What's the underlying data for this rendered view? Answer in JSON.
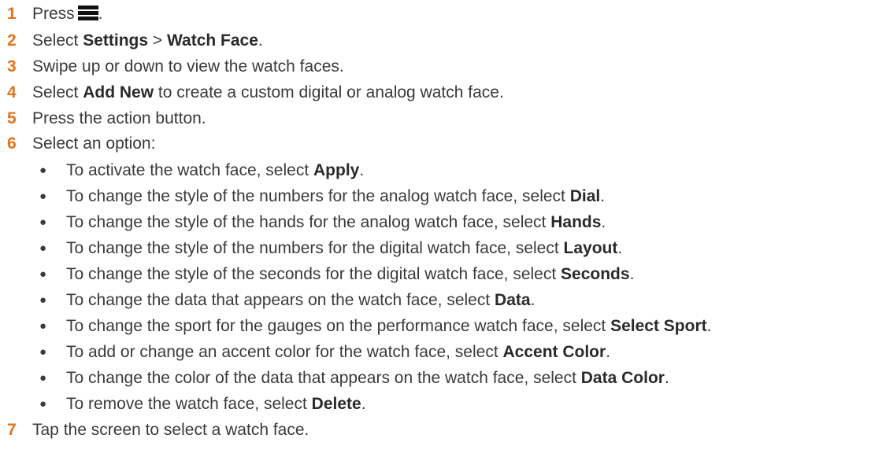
{
  "steps": [
    {
      "num": "1",
      "pre": "Press",
      "post": "."
    },
    {
      "num": "2",
      "pre": "Select ",
      "b1": "Settings",
      "mid": " > ",
      "b2": "Watch Face",
      "post": "."
    },
    {
      "num": "3",
      "text": "Swipe up or down to view the watch faces."
    },
    {
      "num": "4",
      "pre": "Select ",
      "b1": "Add New",
      "post": " to create a custom digital or analog watch face."
    },
    {
      "num": "5",
      "text": "Press the action button."
    },
    {
      "num": "6",
      "text": "Select an option:"
    },
    {
      "num": "7",
      "text": "Tap the screen to select a watch face."
    }
  ],
  "bullet_glyph": "●",
  "options": [
    {
      "pre": "To activate the watch face, select ",
      "b": "Apply",
      "post": "."
    },
    {
      "pre": "To change the style of the numbers for the analog watch face, select ",
      "b": "Dial",
      "post": "."
    },
    {
      "pre": "To change the style of the hands for the analog watch face, select ",
      "b": "Hands",
      "post": "."
    },
    {
      "pre": "To change the style of the numbers for the digital watch face, select ",
      "b": "Layout",
      "post": "."
    },
    {
      "pre": "To change the style of the seconds for the digital watch face, select ",
      "b": "Seconds",
      "post": "."
    },
    {
      "pre": "To change the data that appears on the watch face, select ",
      "b": "Data",
      "post": "."
    },
    {
      "pre": "To change the sport for the gauges on the performance watch face, select ",
      "b": "Select Sport",
      "post": "."
    },
    {
      "pre": "To add or change an accent color for the watch face, select ",
      "b": "Accent Color",
      "post": "."
    },
    {
      "pre": "To change the color of the data that appears on the watch face, select ",
      "b": "Data Color",
      "post": "."
    },
    {
      "pre": "To remove the watch face, select ",
      "b": "Delete",
      "post": "."
    }
  ],
  "menu_icon": "menu-icon",
  "colors": {
    "step_number": "#e0731c",
    "text": "#3a3a3a"
  }
}
